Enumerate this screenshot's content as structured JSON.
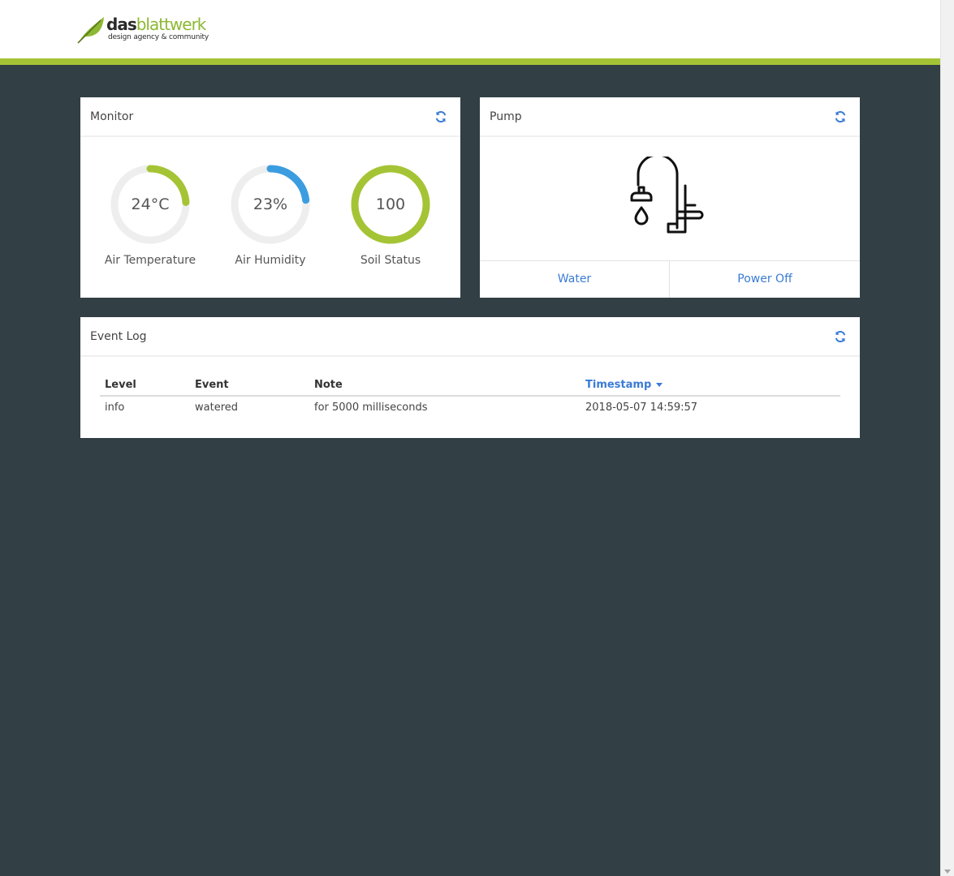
{
  "logo": {
    "part1": "das",
    "part2": "blattwerk",
    "tagline": "design agency & community"
  },
  "monitor": {
    "title": "Monitor",
    "gauges": [
      {
        "value": "24°C",
        "label": "Air Temperature",
        "fraction": 0.24,
        "color": "#a5c435"
      },
      {
        "value": "23%",
        "label": "Air Humidity",
        "fraction": 0.23,
        "color": "#3b9de0"
      },
      {
        "value": "100",
        "label": "Soil Status",
        "fraction": 1.0,
        "color": "#a5c435"
      }
    ]
  },
  "pump": {
    "title": "Pump",
    "icon": "faucet-icon",
    "actions": {
      "water": "Water",
      "power_off": "Power Off"
    }
  },
  "event_log": {
    "title": "Event Log",
    "columns": [
      "Level",
      "Event",
      "Note",
      "Timestamp"
    ],
    "sort_column": "Timestamp",
    "rows": [
      {
        "level": "info",
        "event": "watered",
        "note": "for 5000 milliseconds",
        "timestamp": "2018-05-07 14:59:57"
      }
    ]
  },
  "colors": {
    "accent_green": "#a5c435",
    "accent_blue": "#3a7bd5",
    "background": "#323f45"
  }
}
